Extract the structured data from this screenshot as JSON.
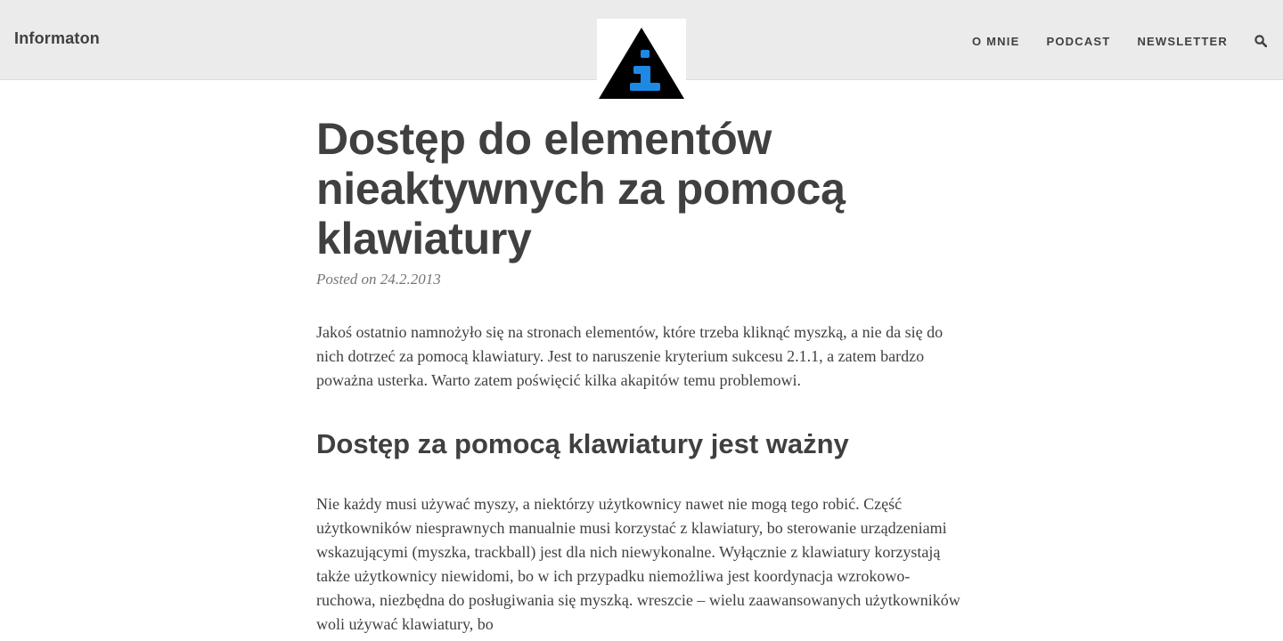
{
  "header": {
    "site_title": "Informaton",
    "nav": [
      {
        "label": "O MNIE"
      },
      {
        "label": "PODCAST"
      },
      {
        "label": "NEWSLETTER"
      }
    ],
    "search_icon": "search-icon",
    "logo_icon": "info-triangle-logo",
    "colors": {
      "header_bg": "#ebebeb",
      "logo_accent": "#1e88e5"
    }
  },
  "post": {
    "title": "Dostęp do elementów nieaktywnych za pomocą klawiatury",
    "meta_prefix": "Posted on",
    "date": "24.2.2013",
    "intro": "Jakoś ostatnio namnożyło się na stronach elementów, które trzeba kliknąć myszką, a nie da się do nich dotrzeć za pomocą klawiatury. Jest to naruszenie kryterium sukcesu 2.1.1, a zatem bardzo poważna usterka. Warto zatem poświęcić kilka akapitów temu problemowi.",
    "section_heading": "Dostęp za pomocą klawiatury jest ważny",
    "section_paragraph": "Nie każdy musi używać myszy, a niektórzy użytkownicy nawet nie mogą tego robić. Część użytkowników niesprawnych manualnie musi korzystać z klawiatury, bo sterowanie urządzeniami wskazującymi (myszka, trackball) jest dla nich niewykonalne. Wyłącznie z klawiatury korzystają także użytkownicy niewidomi, bo w ich przypadku niemożliwa jest koordynacja wzrokowo-ruchowa, niezbędna do posługiwania się myszką. wreszcie – wielu zaawansowanych użytkowników woli używać klawiatury, bo"
  }
}
